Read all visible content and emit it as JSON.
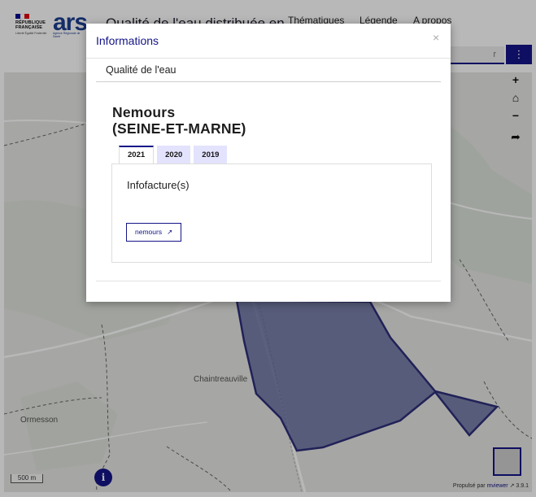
{
  "header": {
    "gov_lines": [
      "RÉPUBLIQUE",
      "FRANÇAISE"
    ],
    "gov_motto": "Liberté Égalité Fraternité",
    "ars_logo": "ars",
    "ars_subtitle": "Agence Régionale de Santé",
    "site_title": "Qualité de l'eau distribuée en",
    "nav": [
      "Thématiques",
      "Légende",
      "A propos"
    ],
    "search_placeholder": "r",
    "menu_icon": "⋮"
  },
  "map": {
    "places": [
      "Chaintreauville",
      "Ormesson"
    ],
    "tools": [
      "+",
      "⌂",
      "−",
      "➦"
    ],
    "scale": "500 m",
    "info_icon": "i",
    "credits_prefix": "Propulsé par",
    "credits_link": "mviewer",
    "credits_version": "3.9.1"
  },
  "modal": {
    "title": "Informations",
    "close": "×",
    "subtitle": "Qualité de l'eau",
    "commune_line1": "Nemours",
    "commune_line2": "(SEINE-ET-MARNE)",
    "tabs": [
      "2021",
      "2020",
      "2019"
    ],
    "active_tab": "2021",
    "section_title": "Infofacture(s)",
    "doc_button": "nemours",
    "external_link_icon": "↗"
  },
  "colors": {
    "primary": "#141488",
    "polygon_fill": "#5a6399",
    "tab_inactive": "#e3e3fd"
  }
}
